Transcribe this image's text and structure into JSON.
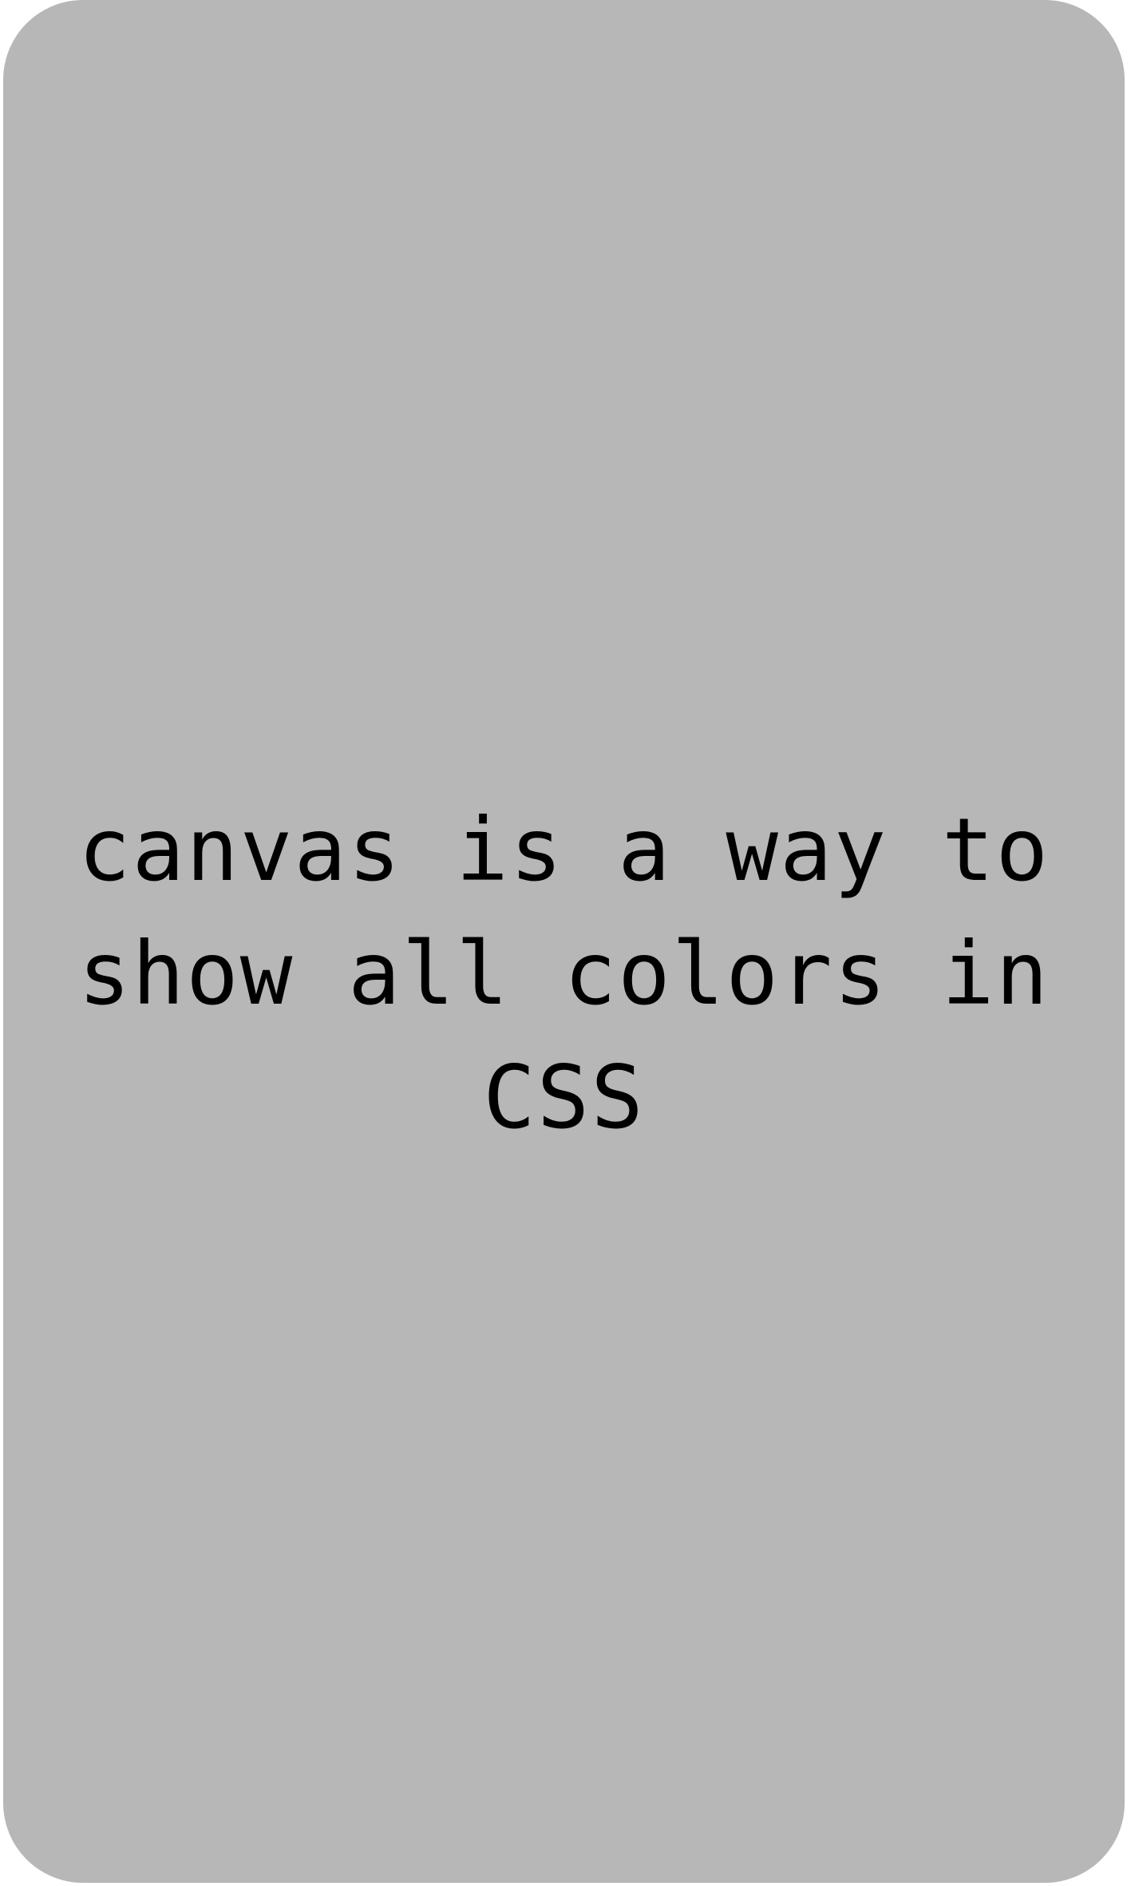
{
  "screen": {
    "message": "canvas is a way to show all colors in CSS",
    "background_color": "#b7b7b7",
    "text_color": "#000000"
  }
}
